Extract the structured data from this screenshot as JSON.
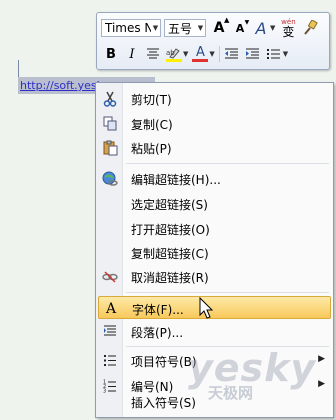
{
  "document": {
    "link_text": "http://soft.yesky"
  },
  "toolbar": {
    "font_name": "Times Ne",
    "font_size": "五号",
    "grow_font": "A",
    "shrink_font": "A",
    "style_label": "A",
    "phonetic_label": "wén",
    "phonetic_char": "变",
    "bold": "B",
    "italic": "I",
    "font_color_label": "A",
    "highlight_color": "#ffef00",
    "font_color": "#e03030"
  },
  "menu": {
    "items": [
      {
        "label": "剪切(T)",
        "icon": "scissors-icon"
      },
      {
        "label": "复制(C)",
        "icon": "copy-icon"
      },
      {
        "label": "粘贴(P)",
        "icon": "paste-icon"
      },
      {
        "label": "编辑超链接(H)...",
        "icon": "hyperlink-icon"
      },
      {
        "label": "选定超链接(S)",
        "icon": ""
      },
      {
        "label": "打开超链接(O)",
        "icon": ""
      },
      {
        "label": "复制超链接(C)",
        "icon": ""
      },
      {
        "label": "取消超链接(R)",
        "icon": "remove-hyperlink-icon"
      },
      {
        "label": "字体(F)...",
        "icon": "font-icon",
        "icon_text": "A",
        "selected": true
      },
      {
        "label": "段落(P)...",
        "icon": "paragraph-icon"
      },
      {
        "label": "项目符号(B)",
        "icon": "bullets-icon",
        "submenu": true
      },
      {
        "label": "编号(N)",
        "icon": "numbering-icon",
        "submenu": true
      },
      {
        "label": "插入符号(S)",
        "icon": ""
      }
    ]
  },
  "watermark": {
    "en": "yesky",
    "cn": "天极网"
  }
}
